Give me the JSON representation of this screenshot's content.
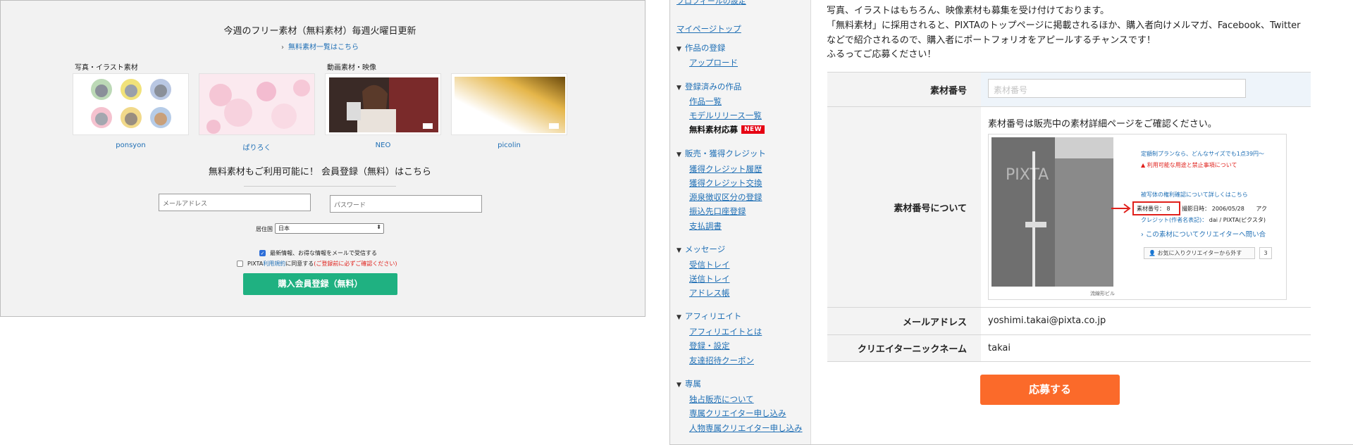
{
  "left": {
    "weekly_title": "今週のフリー素材（無料素材）毎週火曜日更新",
    "free_list_link": "無料素材一覧はこちら",
    "category_photo_illust": "写真・イラスト素材",
    "category_video": "動画素材・映像",
    "thumbnails": [
      {
        "name": "ponsyon"
      },
      {
        "name": "ぱりろく"
      },
      {
        "name": "NEO"
      },
      {
        "name": "picolin"
      }
    ],
    "member_title": "無料素材もご利用可能に！ 会員登録（無料）はこちら",
    "email_placeholder": "メールアドレス",
    "password_placeholder": "パスワード",
    "country_label": "居住国",
    "country_value": "日本",
    "newsletter_label": "最新情報、お得な情報をメールで受信する",
    "terms_prefix": "PIXTA",
    "terms_link": "利用規約",
    "terms_suffix": "に同意する",
    "terms_note": "(ご登録前に必ずご確認ください)",
    "register_button": "購入会員登録（無料）",
    "colors": {
      "accent_green": "#1fb181",
      "link_blue": "#1f6fb5",
      "warning_red": "#e0201b"
    },
    "newsletter_checked": true,
    "terms_checked": false
  },
  "right": {
    "sidebar": {
      "top_cut": "プロフィールの設定",
      "mypage": "マイページトップ",
      "sections": [
        {
          "title": "作品の登録",
          "items": [
            "アップロード"
          ]
        },
        {
          "title": "登録済みの作品",
          "items": [
            "作品一覧",
            "モデルリリース一覧",
            "無料素材応募"
          ]
        },
        {
          "title": "販売・獲得クレジット",
          "items": [
            "獲得クレジット履歴",
            "獲得クレジット交換",
            "源泉徴収区分の登録",
            "振込先口座登録",
            "支払調書"
          ]
        },
        {
          "title": "メッセージ",
          "items": [
            "受信トレイ",
            "送信トレイ",
            "アドレス帳"
          ]
        },
        {
          "title": "アフィリエイト",
          "items": [
            "アフィリエイトとは",
            "登録・設定",
            "友達招待クーポン"
          ]
        },
        {
          "title": "専属",
          "items": [
            "独占販売について",
            "専属クリエイター申し込み",
            "人物専属クリエイター申し込み"
          ]
        }
      ],
      "new_badge": "NEW"
    },
    "intro_lines": [
      "写真、イラストはもちろん、映像素材も募集を受け付けております。",
      "「無料素材」に採用されると、PIXTAのトップページに掲載されるほか、購入者向けメルマガ、Facebook、Twitter",
      "などで紹介されるので、購入者にポートフォリオをアピールするチャンスです！",
      "ふるってご応募ください！"
    ],
    "form": {
      "material_number_label": "素材番号",
      "material_number_placeholder": "素材番号",
      "about_label": "素材番号について",
      "about_note": "素材番号は販売中の素材詳細ページをご確認ください。",
      "sample": {
        "plan_text": "定額制プランなら、どんなサイズでも1点39円〜",
        "warning_text": "利用可能な用途と禁止事項について",
        "rights_link": "被写体の権利確認について詳しくはこちら",
        "number_label": "素材番号：",
        "number_value": "8",
        "shot_date_label": "撮影日時：",
        "shot_date": "2006/05/28",
        "tail": "アク",
        "credit_label": "クレジット(作者名表記)：",
        "credit_value": "dai / PIXTA(ピクスタ)",
        "contact_link": "この素材についてクリエイターへ問い合",
        "fav_button": "お気に入りクリエイターから外す",
        "fav_count": "3",
        "photo_caption": "流線形ビル",
        "watermark": "PIXTA"
      },
      "email_label": "メールアドレス",
      "email_value": "yoshimi.takai@pixta.co.jp",
      "nickname_label": "クリエイターニックネーム",
      "nickname_value": "takai"
    },
    "apply_button": "応募する",
    "colors": {
      "apply_orange": "#fb6a2a",
      "new_red": "#e60012"
    }
  }
}
